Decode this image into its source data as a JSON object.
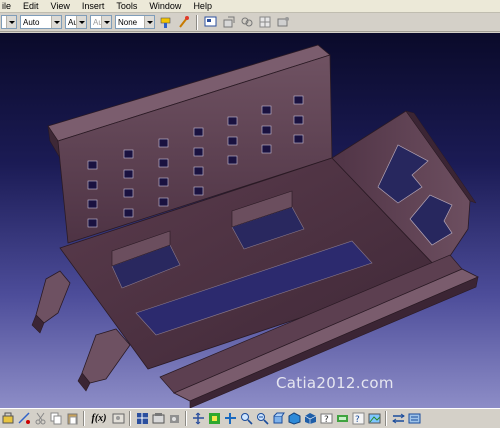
{
  "menubar": {
    "items": [
      {
        "label": "ile"
      },
      {
        "label": "Edit"
      },
      {
        "label": "View"
      },
      {
        "label": "Insert"
      },
      {
        "label": "Tools"
      },
      {
        "label": "Window"
      },
      {
        "label": "Help"
      }
    ]
  },
  "toolbar": {
    "combo_first": "",
    "combo_linetype": "Auto",
    "combo_thickness": "Aut",
    "combo_weight": "Aut",
    "combo_layer": "None",
    "icons": [
      "painter-icon",
      "brush-icon",
      "select-icon",
      "snap-icon",
      "filter-icon",
      "grid-icon",
      "constraint-icon"
    ]
  },
  "viewport": {
    "watermark": "Catia2012.com",
    "part_color": "#5a3b4c",
    "background_top": "#0a0a2a",
    "background_bottom": "#8d8dc7"
  },
  "bottombar": {
    "fx_label": "f(x)",
    "icons": [
      "update-icon",
      "measure-icon",
      "cut-icon",
      "copy-icon",
      "paste-icon",
      "formula-icon",
      "catalog-icon",
      "analysis-icon",
      "table-icon",
      "compass-icon",
      "pan-icon",
      "fit-all-icon",
      "rotate-icon",
      "zoom-in-icon",
      "zoom-out-icon",
      "normal-view-icon",
      "iso-view-icon",
      "render-style-icon",
      "hide-show-icon",
      "swap-space-icon",
      "help-icon",
      "image-icon",
      "layout-icon",
      "material-icon"
    ]
  }
}
